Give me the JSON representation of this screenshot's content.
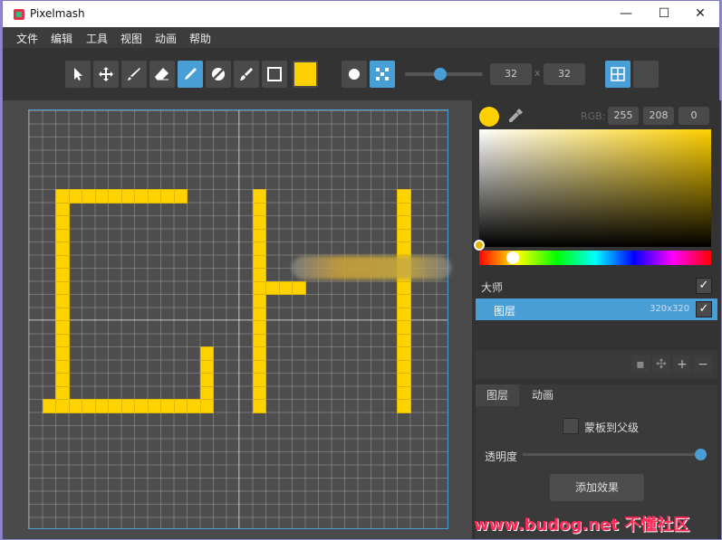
{
  "window": {
    "title": "Pixelmash",
    "controls": {
      "minimize": "—",
      "maximize": "☐",
      "close": "✕"
    }
  },
  "menu": [
    "文件",
    "编辑",
    "工具",
    "视图",
    "动画",
    "帮助"
  ],
  "toolbar": {
    "tools": [
      {
        "icon": "select-arrow-icon",
        "active": false
      },
      {
        "icon": "move-icon",
        "active": false
      },
      {
        "icon": "brush-icon",
        "active": false
      },
      {
        "icon": "eraser-icon",
        "active": false
      },
      {
        "icon": "pencil-icon",
        "active": true
      },
      {
        "icon": "fill-icon",
        "active": false
      },
      {
        "icon": "smudge-icon",
        "active": false
      },
      {
        "icon": "rectangle-icon",
        "active": false
      }
    ],
    "current_color": "#ffd000",
    "brush_shapes": [
      "round-brush-icon",
      "dither-brush-icon"
    ],
    "brush_size_fraction": 0.45,
    "canvas_width": "32",
    "size_separator": "x",
    "canvas_height": "32",
    "view_buttons": [
      "grid-view-icon",
      "single-view-icon"
    ]
  },
  "color_panel": {
    "rgb_label": "RGB:",
    "r": "255",
    "g": "208",
    "b": "0",
    "selected_color": "#ffd000",
    "hue_fraction": 0.145
  },
  "layers": {
    "master_label": "大师",
    "master_checked": "✓",
    "layer_name": "图层",
    "layer_size": "320x320",
    "layer_checked": "✓",
    "buttons": [
      "duplicate-icon",
      "move-layer-icon",
      "+",
      "−"
    ]
  },
  "properties": {
    "tabs": [
      "图层",
      "动画"
    ],
    "mask_label": "蒙板到父级",
    "opacity_label": "透明度",
    "opacity_fraction": 1.0,
    "add_effect_label": "添加效果"
  },
  "watermark": "www.budog.net 不懂社区",
  "colors": {
    "accent": "#4a9ed6",
    "pixel": "#ffd200"
  }
}
